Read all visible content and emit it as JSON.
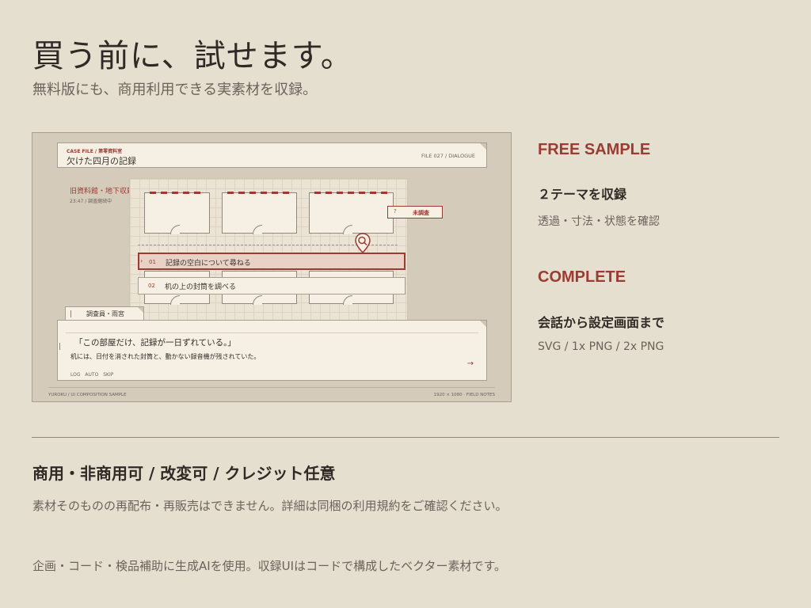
{
  "hero": {
    "title": "買う前に、試せます。",
    "subtitle": "無料版にも、商用利用できる実素材を収録。"
  },
  "preview": {
    "header": {
      "case_label": "CASE FILE / 第零資料室",
      "title": "欠けた四月の記録",
      "file_no": "FILE 027  /  DIALOGUE"
    },
    "location": "旧資料館・地下収蔵室",
    "time_status": "23:47  /  調査継続中",
    "status_tag": {
      "mark": "?",
      "label": "未調査"
    },
    "choices": [
      {
        "num": "01",
        "label": "記録の空白について尋ねる",
        "active": true
      },
      {
        "num": "02",
        "label": "机の上の封筒を調べる",
        "active": false
      }
    ],
    "speaker": "調査員・雨宮",
    "dialog": {
      "quote": "「この部屋だけ、記録が一日ずれている。」",
      "body": "机には、日付を消された封筒と、動かない録音機が残されていた。",
      "controls": "LOG  AUTO  SKIP",
      "next_icon": "arrow-right-icon"
    },
    "footer": {
      "left": "YUROKU  /  UI COMPOSITION SAMPLE",
      "right": "1920 × 1080  ·  FIELD NOTES"
    },
    "colors": {
      "accent": "#9b3b32",
      "paper": "#f5f0e3",
      "background": "#d4cbbb"
    }
  },
  "free_sample": {
    "heading": "FREE SAMPLE",
    "subtitle": "２テーマを収録",
    "note": "透過・寸法・状態を確認"
  },
  "complete": {
    "heading": "COMPLETE",
    "subtitle": "会話から設定画面まで",
    "note": "SVG / 1x PNG / 2x PNG"
  },
  "license": {
    "title": "商用・非商用可  /  改変可  /  クレジット任意",
    "note": "素材そのものの再配布・再販売はできません。詳細は同梱の利用規約をご確認ください。",
    "credit": "企画・コード・検品補助に生成AIを使用。収録UIはコードで構成したベクター素材です。"
  }
}
